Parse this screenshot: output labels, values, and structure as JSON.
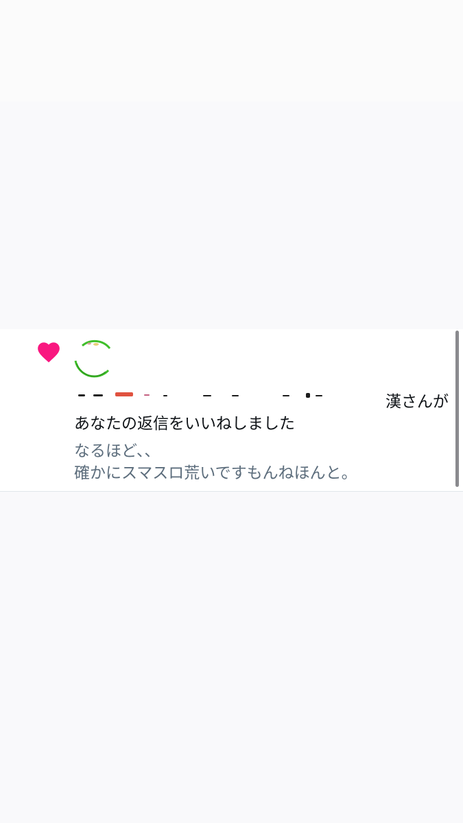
{
  "notification": {
    "type_icon": "heart-icon",
    "name_suffix": "漢さんが",
    "action_text": "あなたの返信をいいねしました",
    "preview_lines": [
      "なるほど、、",
      "確かにスマスロ荒いですもんねほんと。"
    ]
  },
  "colors": {
    "heart": "#f91880",
    "avatar_ring": "#3fbf2a",
    "preview_text": "#5c6d7c",
    "primary_text": "#101418"
  }
}
